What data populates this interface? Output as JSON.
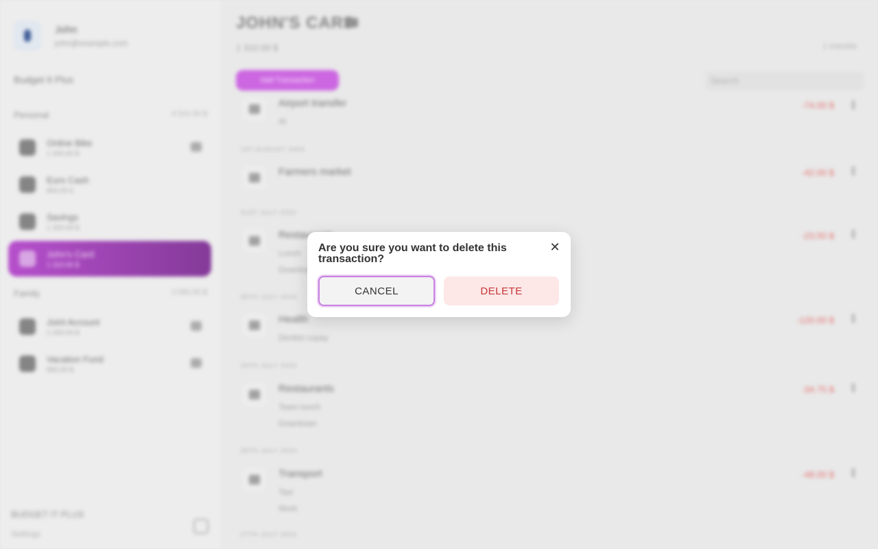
{
  "sidebar": {
    "user": {
      "name": "John",
      "email": "john@example.com"
    },
    "budget_link": "Budget It Plus",
    "groups": [
      {
        "label": "Personal",
        "amount": "4 510.00 $"
      },
      {
        "label": "Family",
        "amount": "3 090.00 $"
      }
    ],
    "accounts": [
      {
        "name": "Online Bike",
        "balance": "1 200.00 $"
      },
      {
        "name": "Euro Cash",
        "balance": "800.00 €"
      },
      {
        "name": "Savings",
        "balance": "1 200.00 $"
      },
      {
        "name": "John's Card",
        "balance": "1 310.00 $"
      },
      {
        "name": "Joint Account",
        "balance": "2 200.00 $"
      },
      {
        "name": "Vacation Fund",
        "balance": "890.00 $"
      }
    ],
    "footer": {
      "title": "BUDGET IT PLUS",
      "subtitle": "Settings"
    }
  },
  "main": {
    "title": "JOHN'S CARD",
    "balance": "1 310.00 $",
    "right_label": "1 transfer",
    "add_button": "Add Transaction",
    "search_placeholder": "Search",
    "dates": [
      "1ST AUGUST 2024",
      "31ST JULY 2024",
      "30TH JULY 2024",
      "29TH JULY 2024",
      "28TH JULY 2024",
      "27TH JULY 2024"
    ],
    "transactions": [
      {
        "name": "Airport transfer",
        "sub1": "At ",
        "sub2": "",
        "amount": "-74.00 $"
      },
      {
        "name": "Farmers market",
        "sub1": "",
        "sub2": "",
        "amount": "-42.00 $"
      },
      {
        "name": "Restaurants",
        "sub1": "Lunch",
        "sub2": "Downtown",
        "amount": "-23.50 $"
      },
      {
        "name": "Health",
        "sub1": "Dentist copay",
        "sub2": "",
        "amount": "-120.00 $"
      },
      {
        "name": "Restaurants",
        "sub1": "Team lunch",
        "sub2": "Downtown",
        "amount": "-34.75 $"
      },
      {
        "name": "Transport",
        "sub1": "Taxi",
        "sub2": "Work",
        "amount": "-48.00 $"
      }
    ]
  },
  "modal": {
    "title": "Are you sure you want to delete this transaction?",
    "cancel_label": "CANCEL",
    "delete_label": "DELETE",
    "close_glyph": "✕"
  },
  "colors": {
    "accent": "#c85adf",
    "delete_bg": "#fde7e7",
    "delete_text": "#c63636",
    "focus_ring": "#c781df"
  }
}
